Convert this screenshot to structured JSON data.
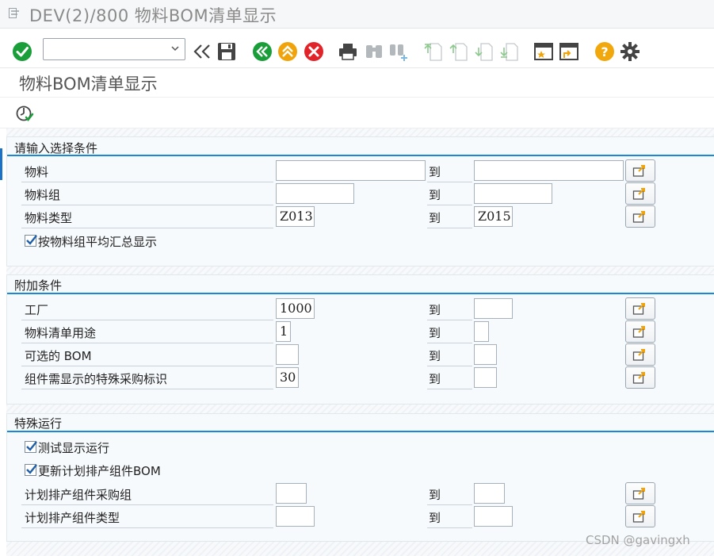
{
  "window": {
    "title": "DEV(2)/800 物料BOM清单显示"
  },
  "program": {
    "title": "物料BOM清单显示"
  },
  "toolbar": {
    "command_value": "",
    "icons": [
      "enter-icon",
      "back-icon",
      "save-icon",
      "back-green-icon",
      "exit-icon",
      "cancel-icon",
      "print-icon",
      "find-icon",
      "find-next-icon",
      "first-page-icon",
      "previous-page-icon",
      "next-page-icon",
      "last-page-icon",
      "new-session-icon",
      "shortcut-icon",
      "help-icon",
      "settings-icon"
    ]
  },
  "sections": {
    "selection": {
      "title": "请输入选择条件",
      "rows": [
        {
          "label": "物料",
          "low": "",
          "to": "到",
          "high": ""
        },
        {
          "label": "物料组",
          "low": "",
          "to": "到",
          "high": ""
        },
        {
          "label": "物料类型",
          "low": "Z013",
          "to": "到",
          "high": "Z015"
        }
      ],
      "checkbox_label": "按物料组平均汇总显示",
      "checkbox_checked": true
    },
    "additional": {
      "title": "附加条件",
      "rows": [
        {
          "label": "工厂",
          "low": "1000",
          "to": "到",
          "high": ""
        },
        {
          "label": "物料清单用途",
          "low": "1",
          "to": "到",
          "high": ""
        },
        {
          "label": "可选的 BOM",
          "low": "",
          "to": "到",
          "high": ""
        },
        {
          "label": "组件需显示的特殊采购标识",
          "low": "30",
          "to": "到",
          "high": ""
        }
      ]
    },
    "special": {
      "title": "特殊运行",
      "checkboxes": [
        {
          "label": "测试显示运行",
          "checked": true
        },
        {
          "label": "更新计划排产组件BOM",
          "checked": true
        }
      ],
      "rows": [
        {
          "label": "计划排产组件采购组",
          "low": "",
          "to": "到",
          "high": ""
        },
        {
          "label": "计划排产组件类型",
          "low": "",
          "to": "到",
          "high": ""
        }
      ]
    }
  },
  "watermark": "CSDN @gavingxh",
  "colors": {
    "accent": "#1a88d6",
    "enter_green": "#1a9e3a",
    "exit_orange": "#f0a30a",
    "cancel_red": "#e0242a",
    "help_yellow": "#f0a80c"
  }
}
